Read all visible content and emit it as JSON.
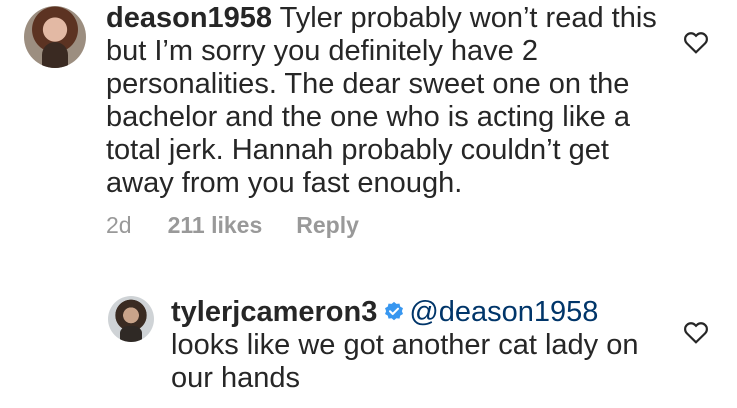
{
  "comments": [
    {
      "username": "deason1958",
      "text": "Tyler probably won’t read this but I’m sorry you definitely have 2 personalities. The dear sweet one on the bachelor and the one who is acting like a total jerk. Hannah probably couldn’t get away from you fast enough.",
      "time": "2d",
      "likes": "211 likes",
      "reply_label": "Reply"
    },
    {
      "username": "tylerjcameron3",
      "verified": true,
      "mention": "@deason1958",
      "text": "looks like we got another cat lady on our hands"
    }
  ],
  "icons": {
    "like": "heart-outline-icon",
    "verified": "verified-badge-icon"
  },
  "colors": {
    "text": "#262626",
    "meta": "#999999",
    "mention": "#003569",
    "verified": "#3897f0"
  }
}
